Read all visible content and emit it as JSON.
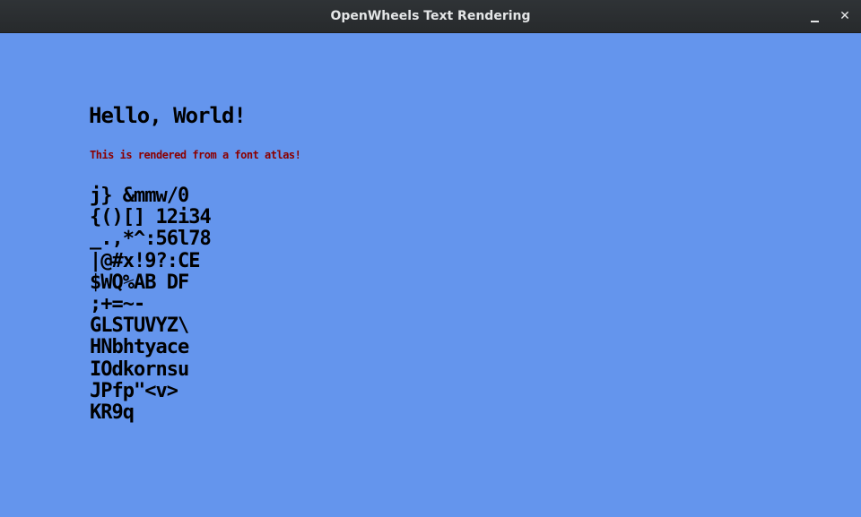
{
  "window": {
    "title": "OpenWheels Text Rendering",
    "minimize_icon": "minimize-icon",
    "close_glyph": "✕",
    "close_icon": "close-icon"
  },
  "canvas": {
    "background": "#6495ED",
    "heading": "Hello, World!",
    "heading_color": "#000000",
    "subtitle": "This is rendered from a font atlas!",
    "subtitle_color": "#8B0000",
    "atlas_rows": [
      "j} &mmw/0",
      "{()[] 12i34",
      "_.,*^:56l78",
      "|@#x!9?:CE",
      "$WQ%AB DF",
      ";+=~-   ",
      "GLSTUVYZ\\",
      "HNbhtyace",
      "IOdkornsu",
      "JPfp\"<v>",
      "KR9q"
    ]
  }
}
